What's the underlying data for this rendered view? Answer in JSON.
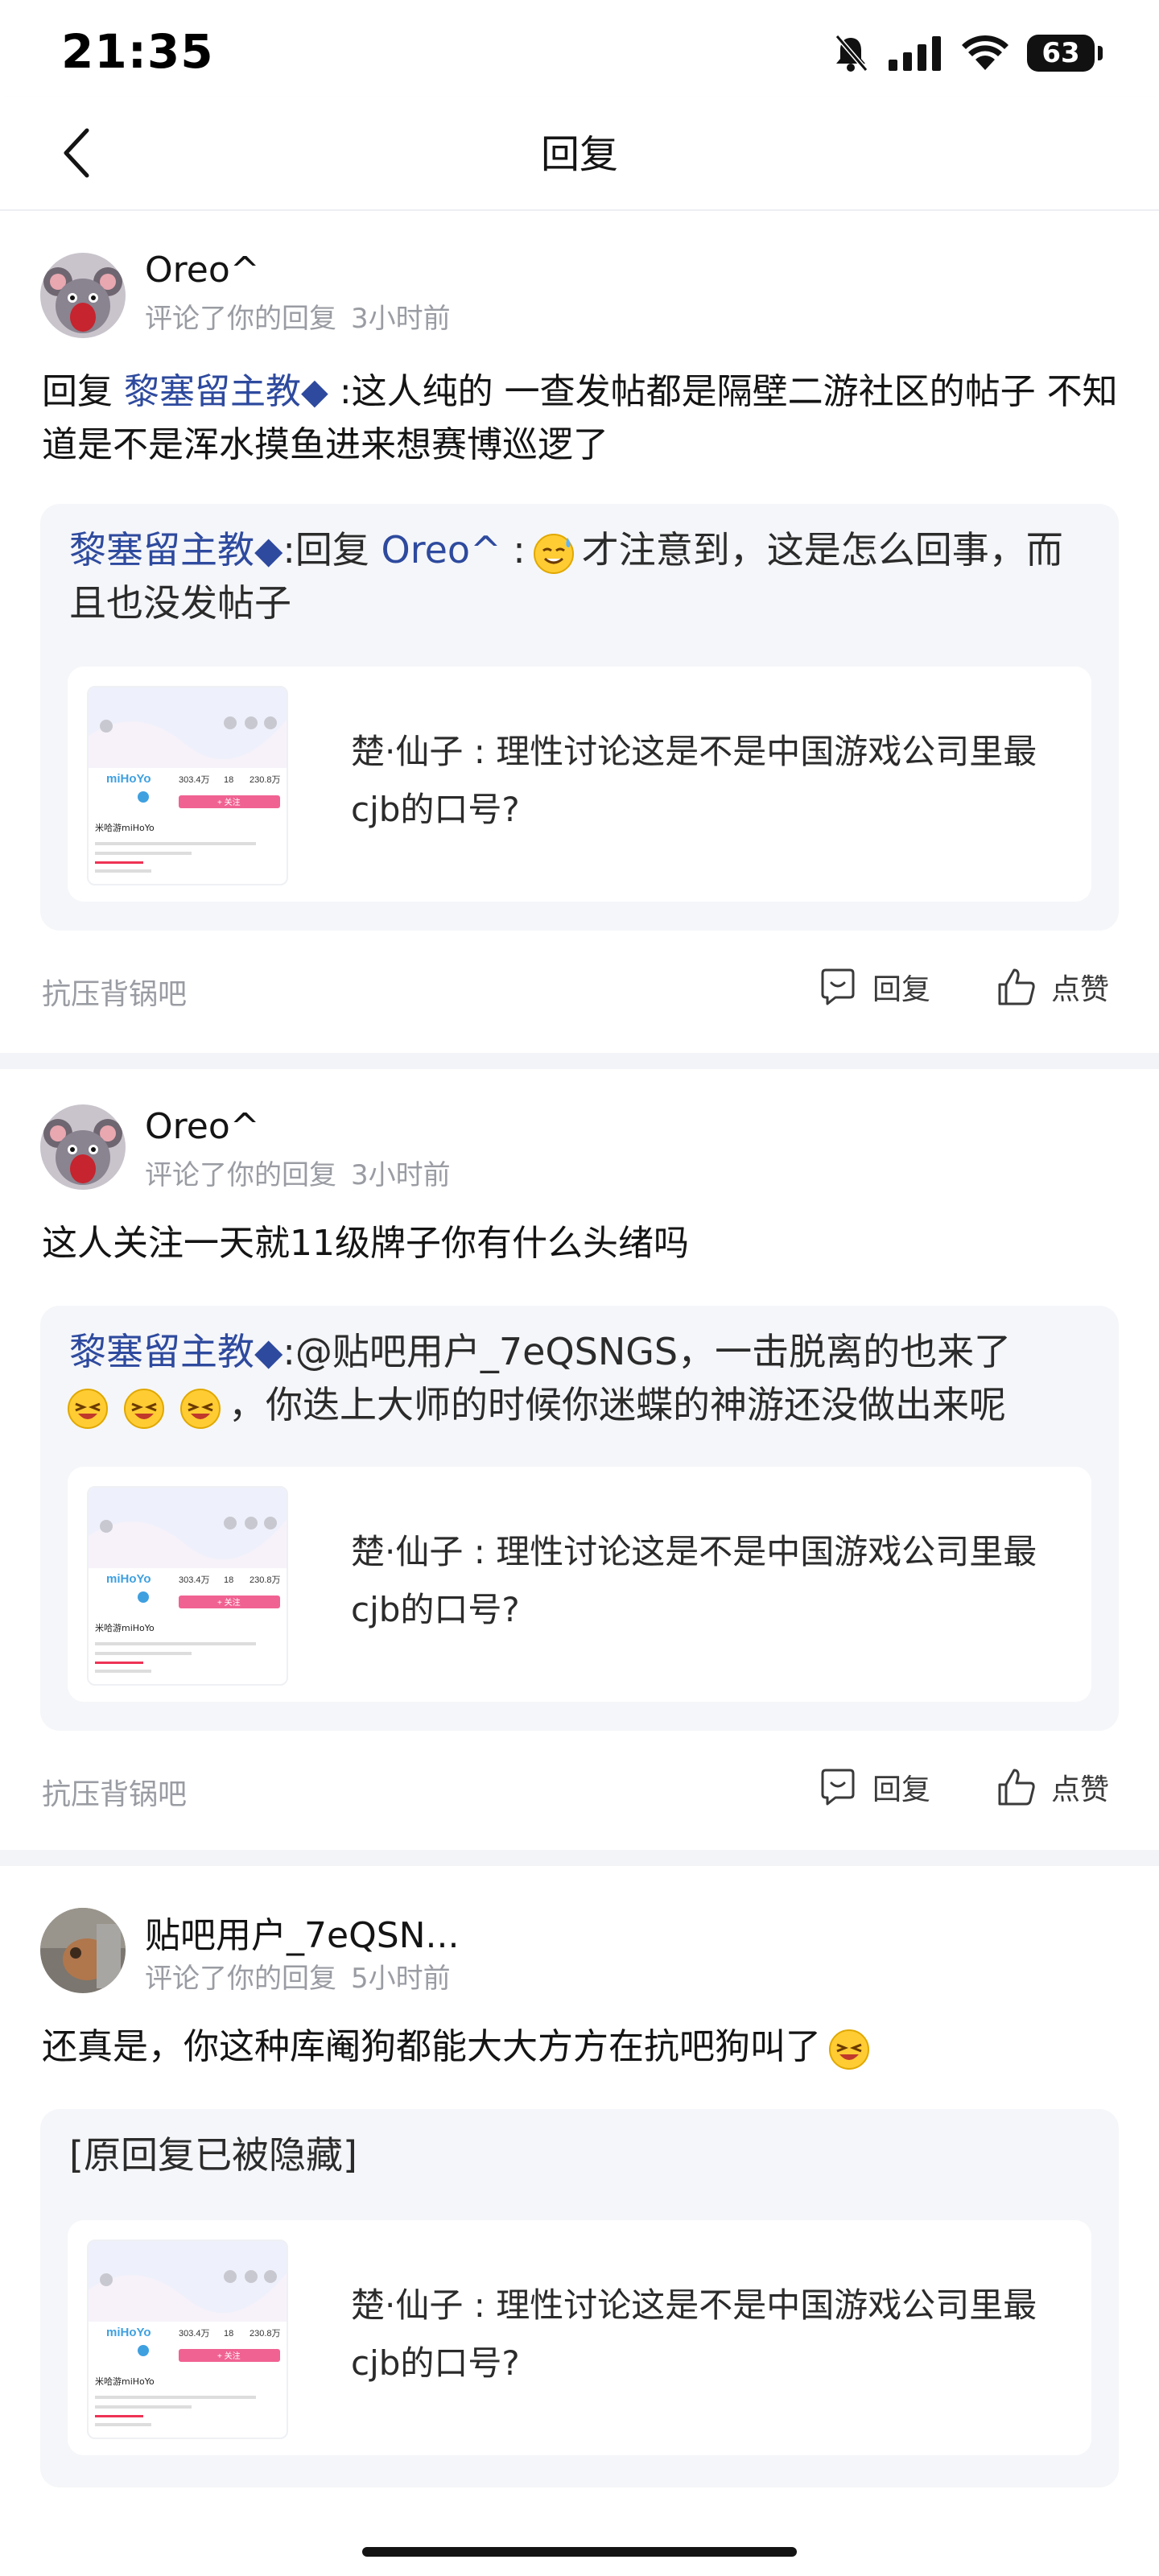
{
  "status": {
    "time": "21:35",
    "battery": "63"
  },
  "nav": {
    "title": "回复"
  },
  "items": [
    {
      "username": "Oreo^",
      "action": "评论了你的回复",
      "time": "3小时前",
      "content_prefix": "回复",
      "content_link": "黎塞留主教◆",
      "content_rest": ":这人纯的 一查发帖都是隔壁二游社区的帖子 不知道是不是浑水摸鱼进来想赛博巡逻了",
      "quote_author": "黎塞留主教◆",
      "quote_sep": ":回复",
      "quote_link": "Oreo^",
      "quote_colon": ":",
      "quote_text": "才注意到，这是怎么回事，而且也没发帖子",
      "post_text": "楚·仙子 : 理性讨论这是不是中国游戏公司里最cjb的口号?",
      "forum": "抗压背锅吧",
      "reply_label": "回复",
      "like_label": "点赞"
    },
    {
      "username": "Oreo^",
      "action": "评论了你的回复",
      "time": "3小时前",
      "content": "这人关注一天就11级牌子你有什么头绪吗",
      "quote_author": "黎塞留主教◆",
      "quote_line1": ":@贴吧用户_7eQSNGS，一击脱离的也来了",
      "quote_line2": "，你迭上大师的时候你迷蝶的神游还没做出来呢",
      "post_text": "楚·仙子 : 理性讨论这是不是中国游戏公司里最cjb的口号?",
      "forum": "抗压背锅吧",
      "reply_label": "回复",
      "like_label": "点赞"
    },
    {
      "username": "贴吧用户_7eQSN...",
      "action": "评论了你的回复",
      "time": "5小时前",
      "content": "还真是，你这种库阉狗都能大大方方在抗吧狗叫了",
      "quote_text": "[原回复已被隐藏]",
      "post_text": "楚·仙子 : 理性讨论这是不是中国游戏公司里最cjb的口号?"
    }
  ],
  "thumb": {
    "brand": "miHoYo",
    "name": "米哈游miHoYo",
    "stat1": "303.4万",
    "stat2": "18",
    "stat3": "230.8万",
    "follow": "+ 关注"
  },
  "colors": {
    "link": "#2e4a9e",
    "quote_bg": "#f5f6f9",
    "separator": "#f3f4f7",
    "meta": "#9a9ca3",
    "follow_button": "#f06292"
  },
  "icons": [
    "back-chevron-icon",
    "bell-muted-icon",
    "signal-icon",
    "wifi-icon",
    "battery-icon",
    "reply-bubble-icon",
    "thumbs-up-icon",
    "grin-emoji-icon",
    "sweat-emoji-icon"
  ]
}
